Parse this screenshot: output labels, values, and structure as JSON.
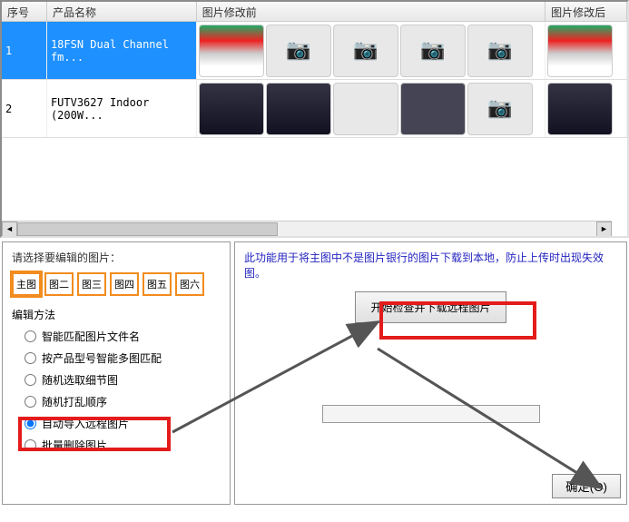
{
  "table": {
    "headers": {
      "seq": "序号",
      "name": "产品名称",
      "before": "图片修改前",
      "after": "图片修改后"
    },
    "rows": [
      {
        "seq": "1",
        "name": "18FSN Dual Channel fm..."
      },
      {
        "seq": "2",
        "name": "FUTV3627 Indoor (200W..."
      }
    ]
  },
  "left": {
    "prompt": "请选择要编辑的图片：",
    "imgButtons": [
      "主图",
      "图二",
      "图三",
      "图四",
      "图五",
      "图六"
    ],
    "groupLabel": "编辑方法",
    "radios": [
      "智能匹配图片文件名",
      "按产品型号智能多图匹配",
      "随机选取细节图",
      "随机打乱顺序",
      "自动导入远程图片",
      "批量删除图片"
    ],
    "checkedIndex": 4
  },
  "right": {
    "desc": "此功能用于将主图中不是图片银行的图片下载到本地，防止上传时出现失效图。",
    "actionBtn": "开始检查并下载远程图片"
  },
  "okBtn": "确定(O)"
}
